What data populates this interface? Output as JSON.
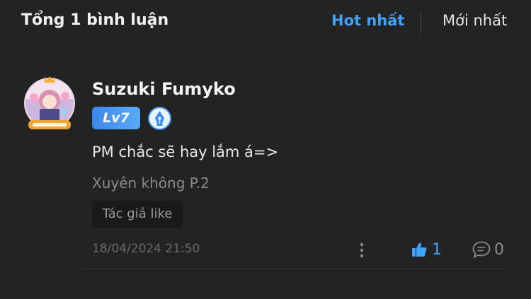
{
  "header": {
    "total_label": "Tổng 1 bình luận",
    "sort_hot": "Hot nhất",
    "sort_new": "Mới nhất",
    "active_sort": "Hot nhất"
  },
  "comment": {
    "username": "Suzuki Fumyko",
    "level": "Lv7",
    "text": "PM chắc sẽ hay lắm á=>",
    "chapter": "Xuyên không P.2",
    "author_like_tag": "Tác giả like",
    "timestamp": "18/04/2024 21:50",
    "like_count": "1",
    "reply_count": "0"
  },
  "colors": {
    "background": "#232323",
    "accent": "#3fa3ff",
    "muted": "#8a8a8a"
  },
  "icons": {
    "avatar": "user-avatar",
    "pen_badge": "pen-badge-icon",
    "more": "more-vertical-icon",
    "like": "thumbs-up-icon",
    "reply": "comment-icon"
  }
}
